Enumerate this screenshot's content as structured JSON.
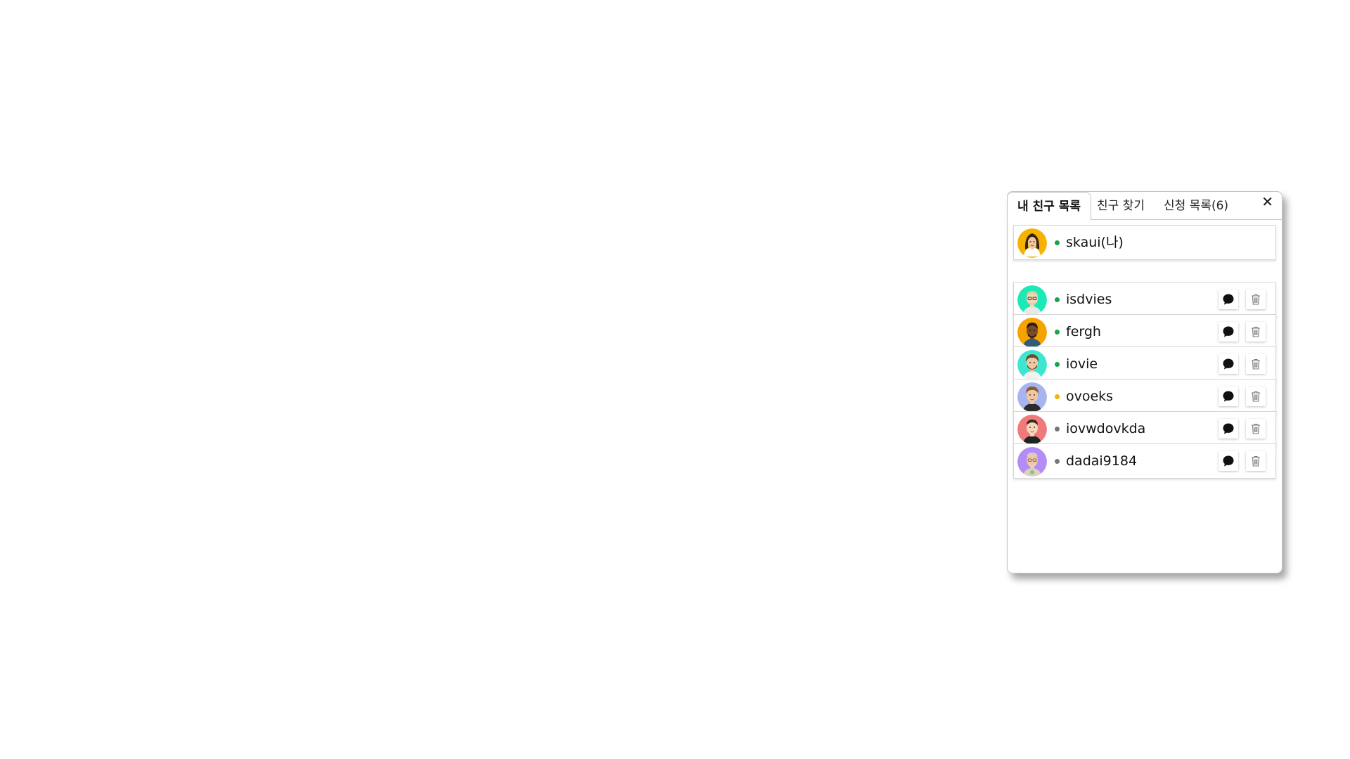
{
  "tabs": {
    "my_friends": "내 친구 목록",
    "find_friends": "친구 찾기",
    "requests": "신청 목록(6)"
  },
  "close_label": "✕",
  "me": {
    "name": "skaui(나)",
    "status_color": "#1aa34a",
    "avatar_bg": "#f5b300"
  },
  "friends": [
    {
      "name": "isdvies",
      "status_color": "#1aa34a",
      "avatar_bg": "#1de9b6",
      "avatar": "glasses-man-avatar"
    },
    {
      "name": "fergh",
      "status_color": "#1aa34a",
      "avatar_bg": "#f5a300",
      "avatar": "dark-man-avatar"
    },
    {
      "name": "iovie",
      "status_color": "#1aa34a",
      "avatar_bg": "#3ee6d0",
      "avatar": "bearded-man-avatar"
    },
    {
      "name": "ovoeks",
      "status_color": "#f5b300",
      "avatar_bg": "#a8b4f0",
      "avatar": "brown-hair-man-avatar"
    },
    {
      "name": "iovwdovkda",
      "status_color": "#777777",
      "avatar_bg": "#f07a7a",
      "avatar": "red-bg-man-avatar"
    },
    {
      "name": "dadai9184",
      "status_color": "#777777",
      "avatar_bg": "#b38cf5",
      "avatar": "old-man-avatar"
    }
  ],
  "icons": {
    "chat": "chat-bubble-icon",
    "delete": "trash-icon"
  }
}
